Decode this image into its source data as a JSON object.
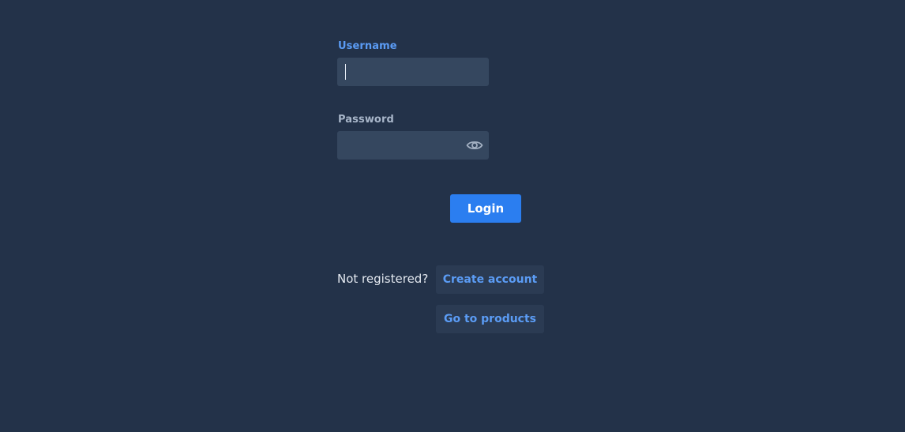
{
  "login_form": {
    "username": {
      "label": "Username",
      "value": "",
      "placeholder": ""
    },
    "password": {
      "label": "Password",
      "value": "",
      "placeholder": "",
      "toggle_icon": "eye-icon"
    },
    "login_label": "Login"
  },
  "footer": {
    "not_registered_text": "Not registered?",
    "create_account_label": "Create account",
    "go_to_products_label": "Go to products"
  },
  "colors": {
    "background": "#233249",
    "input_background": "#35475f",
    "accent": "#2b7ef0",
    "link": "#5b9cf5",
    "secondary_button": "#2b3b53"
  }
}
